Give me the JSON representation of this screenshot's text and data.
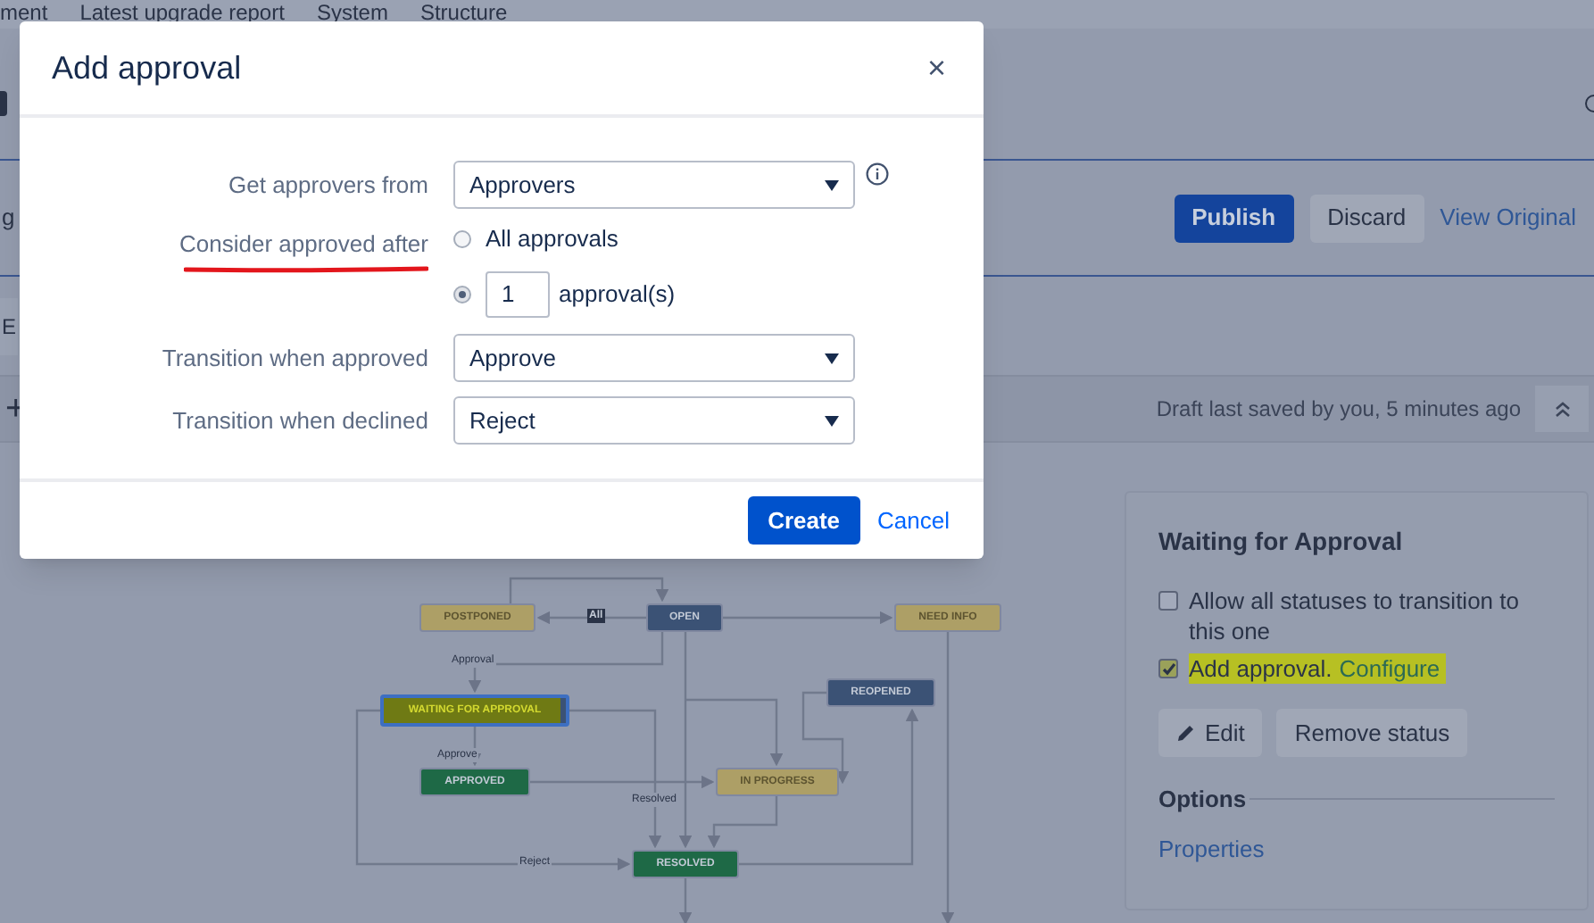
{
  "top_nav": {
    "items": [
      "ment",
      "Latest upgrade report",
      "System",
      "Structure"
    ]
  },
  "header": {
    "text_fragment": "g",
    "publish": "Publish",
    "discard": "Discard",
    "view_original": "View Original"
  },
  "tab_fragment": "E",
  "toolbar": {
    "add": "+",
    "draft_status": "Draft last saved by you, 5 minutes ago"
  },
  "diagram": {
    "nodes": [
      {
        "label": "POSTPONED",
        "color": "#ad9f66",
        "selected": false
      },
      {
        "label": "OPEN",
        "color": "#3b5275",
        "selected": false
      },
      {
        "label": "NEED INFO",
        "color": "#ad9f66",
        "selected": false
      },
      {
        "label": "REOPENED",
        "color": "#3b5275",
        "selected": false
      },
      {
        "label": "WAITING FOR APPROVAL",
        "color": "#3b5275",
        "selected": true
      },
      {
        "label": "APPROVED",
        "color": "#1e6946",
        "selected": false
      },
      {
        "label": "IN PROGRESS",
        "color": "#ad9f66",
        "selected": false
      },
      {
        "label": "RESOLVED",
        "color": "#1e6946",
        "selected": false
      }
    ],
    "transition_labels": [
      "All",
      "Approval",
      "Approve",
      "Resolved",
      "Reject"
    ]
  },
  "panel": {
    "title": "Waiting for Approval",
    "options": [
      {
        "label": "Allow all statuses to transition to this one",
        "checked": false,
        "highlighted": false
      },
      {
        "label": "Add approval.",
        "link": "Configure",
        "checked": true,
        "highlighted": true
      }
    ],
    "buttons": [
      {
        "kind": "edit",
        "label": "Edit"
      },
      {
        "kind": "plain",
        "label": "Remove status"
      }
    ],
    "section": "Options",
    "link": "Properties"
  },
  "dialog": {
    "title": "Add approval",
    "close": "×",
    "approvers": {
      "label": "Get approvers from",
      "value": "Approvers"
    },
    "consider": {
      "label": "Consider approved after",
      "underlined": true,
      "choices": [
        {
          "kind": "plain",
          "label": "All approvals",
          "selected": false
        },
        {
          "kind": "count",
          "value": "1",
          "label": "approval(s)",
          "selected": true
        }
      ]
    },
    "transitions": [
      {
        "label": "Transition when approved",
        "value": "Approve"
      },
      {
        "label": "Transition when declined",
        "value": "Reject"
      }
    ],
    "create": "Create",
    "cancel": "Cancel"
  }
}
